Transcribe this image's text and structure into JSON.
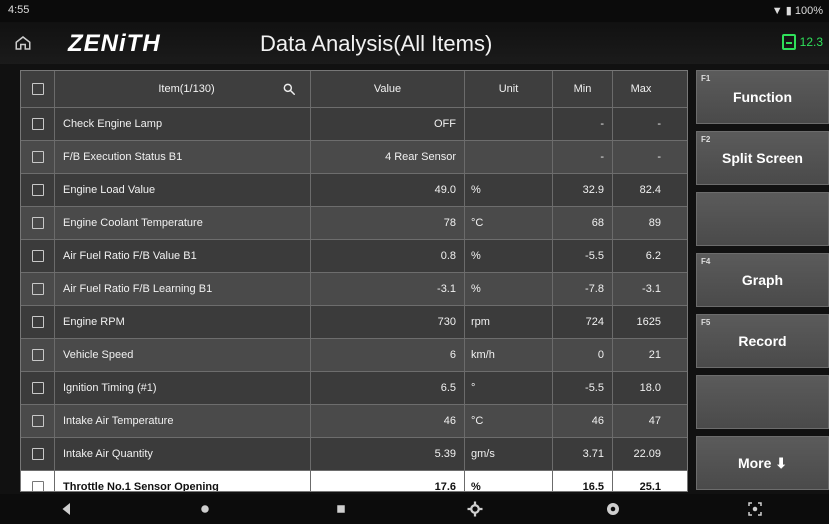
{
  "status_bar": {
    "time": "4:55",
    "battery_percent": "100%"
  },
  "header": {
    "logo": "ZENiTH",
    "title": "Data Analysis(All Items)",
    "battery_voltage": "12.3"
  },
  "table": {
    "headers": {
      "item": "Item(1/130)",
      "value": "Value",
      "unit": "Unit",
      "min": "Min",
      "max": "Max"
    },
    "rows": [
      {
        "item": "Check Engine Lamp",
        "value": "OFF",
        "unit": "",
        "min": "-",
        "max": "-"
      },
      {
        "item": "F/B Execution Status B1",
        "value": "4 Rear Sensor",
        "unit": "",
        "min": "-",
        "max": "-"
      },
      {
        "item": "Engine Load Value",
        "value": "49.0",
        "unit": "%",
        "min": "32.9",
        "max": "82.4"
      },
      {
        "item": "Engine Coolant Temperature",
        "value": "78",
        "unit": "°C",
        "min": "68",
        "max": "89"
      },
      {
        "item": "Air Fuel Ratio F/B Value B1",
        "value": "0.8",
        "unit": "%",
        "min": "-5.5",
        "max": "6.2"
      },
      {
        "item": "Air Fuel Ratio F/B Learning B1",
        "value": "-3.1",
        "unit": "%",
        "min": "-7.8",
        "max": "-3.1"
      },
      {
        "item": "Engine RPM",
        "value": "730",
        "unit": "rpm",
        "min": "724",
        "max": "1625"
      },
      {
        "item": "Vehicle Speed",
        "value": "6",
        "unit": "km/h",
        "min": "0",
        "max": "21"
      },
      {
        "item": "Ignition Timing (#1)",
        "value": "6.5",
        "unit": "°",
        "min": "-5.5",
        "max": "18.0"
      },
      {
        "item": "Intake Air Temperature",
        "value": "46",
        "unit": "°C",
        "min": "46",
        "max": "47"
      },
      {
        "item": "Intake Air Quantity",
        "value": "5.39",
        "unit": "gm/s",
        "min": "3.71",
        "max": "22.09"
      },
      {
        "item": "Throttle No.1 Sensor Opening",
        "value": "17.6",
        "unit": "%",
        "min": "16.5",
        "max": "25.1"
      }
    ]
  },
  "side_buttons": [
    {
      "fkey": "F1",
      "label": "Function"
    },
    {
      "fkey": "F2",
      "label": "Split Screen"
    },
    {
      "fkey": "",
      "label": ""
    },
    {
      "fkey": "F4",
      "label": "Graph"
    },
    {
      "fkey": "F5",
      "label": "Record"
    },
    {
      "fkey": "",
      "label": ""
    },
    {
      "fkey": "",
      "label": "More ⬇"
    }
  ]
}
